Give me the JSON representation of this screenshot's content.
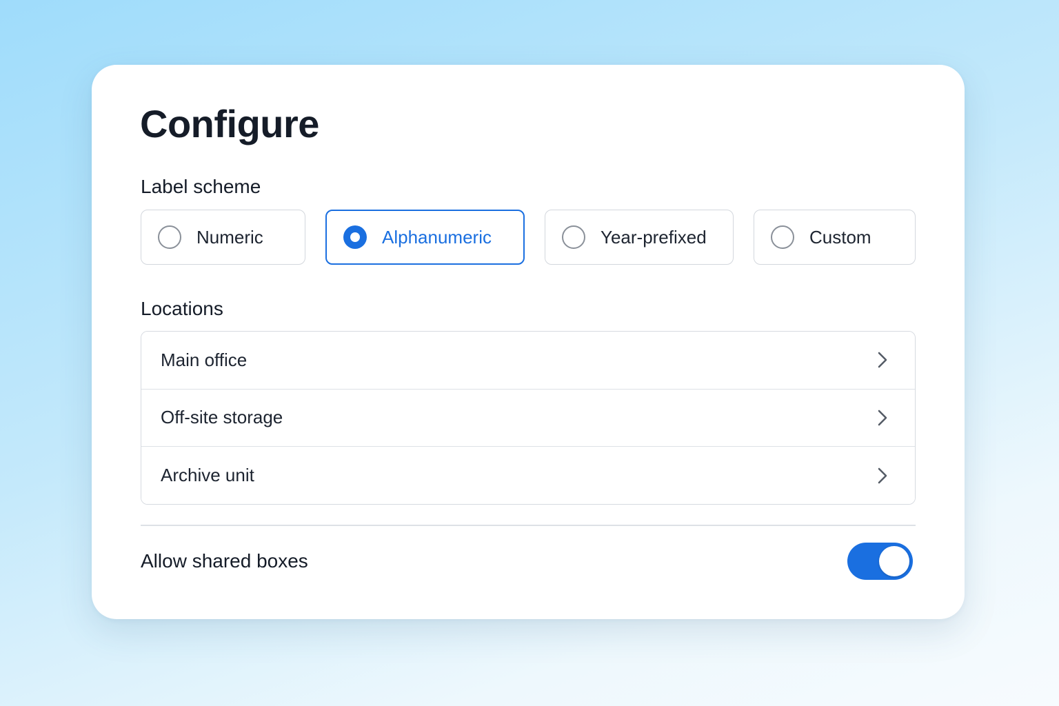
{
  "page": {
    "title": "Configure"
  },
  "label_scheme": {
    "heading": "Label scheme",
    "selected": "Alphanumeric",
    "options": [
      {
        "label": "Numeric",
        "selected": false
      },
      {
        "label": "Alphanumeric",
        "selected": true
      },
      {
        "label": "Year-prefixed",
        "selected": false
      },
      {
        "label": "Custom",
        "selected": false
      }
    ]
  },
  "locations": {
    "heading": "Locations",
    "items": [
      {
        "label": "Main office",
        "icon": "chevron-right-icon"
      },
      {
        "label": "Off-site storage",
        "icon": "chevron-right-icon"
      },
      {
        "label": "Archive unit",
        "icon": "chevron-right-icon"
      }
    ]
  },
  "shared_boxes": {
    "label": "Allow shared boxes",
    "enabled": true
  },
  "colors": {
    "accent": "#1a6fe0",
    "text": "#151c28",
    "border": "#d3d7dd",
    "card_background": "#ffffff"
  }
}
